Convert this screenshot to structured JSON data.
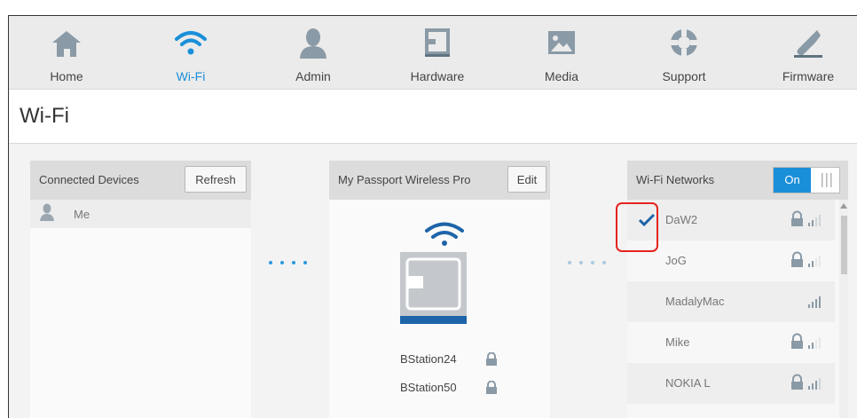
{
  "nav": {
    "items": [
      {
        "label": "Home",
        "icon": "home-icon"
      },
      {
        "label": "Wi-Fi",
        "icon": "wifi-icon"
      },
      {
        "label": "Admin",
        "icon": "admin-user-icon"
      },
      {
        "label": "Hardware",
        "icon": "hardware-drive-icon"
      },
      {
        "label": "Media",
        "icon": "media-image-icon"
      },
      {
        "label": "Support",
        "icon": "support-lifebuoy-icon"
      },
      {
        "label": "Firmware",
        "icon": "firmware-wrench-icon"
      }
    ],
    "active": "Wi-Fi"
  },
  "page": {
    "title": "Wi-Fi"
  },
  "connected_devices": {
    "title": "Connected Devices",
    "refresh_label": "Refresh",
    "devices": [
      {
        "name": "Me"
      }
    ]
  },
  "drive": {
    "title": "My Passport Wireless Pro",
    "edit_label": "Edit",
    "ssids": [
      {
        "name": "BStation24",
        "secured": true
      },
      {
        "name": "BStation50",
        "secured": true
      }
    ]
  },
  "wifi_networks": {
    "title": "Wi-Fi Networks",
    "toggle_label": "On",
    "networks": [
      {
        "name": "DaW2",
        "connected": true,
        "secured": true,
        "signal_bars": 3
      },
      {
        "name": "JoG",
        "connected": false,
        "secured": true,
        "signal_bars": 2
      },
      {
        "name": "MadalyMac",
        "connected": false,
        "secured": false,
        "signal_bars": 4
      },
      {
        "name": "Mike",
        "connected": false,
        "secured": true,
        "signal_bars": 2
      },
      {
        "name": "NOKIA L",
        "connected": false,
        "secured": true,
        "signal_bars": 3
      }
    ]
  },
  "colors": {
    "accent": "#1a8fd9",
    "annotation": "#e52420",
    "drive_stripe": "#1e64a8"
  }
}
